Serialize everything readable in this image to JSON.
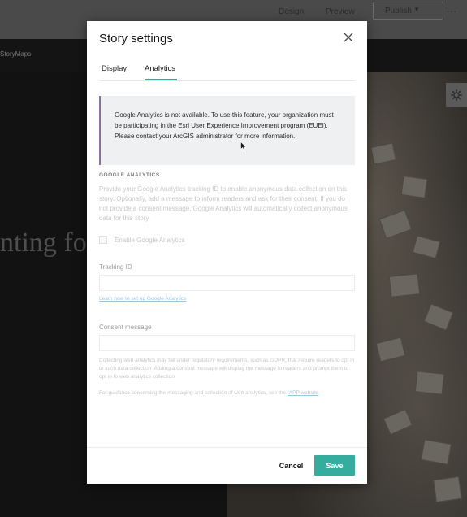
{
  "app": {
    "nav": {
      "design_label": "Design",
      "preview_label": "Preview",
      "publish_label": "Publish",
      "more_label": "..."
    },
    "brand_text": "StoryMaps",
    "hero_text": "nting fo"
  },
  "modal": {
    "title": "Story settings",
    "tabs": [
      {
        "label": "Display",
        "active": false
      },
      {
        "label": "Analytics",
        "active": true
      }
    ],
    "notice": {
      "text": "Google Analytics is not available. To use this feature, your organization must be participating in the Esri User Experience Improvement program (EUEI). Please contact your ArcGIS administrator for more information.",
      "accent_color": "#8f6fa3"
    },
    "section_heading": "GOOGLE ANALYTICS",
    "description": "Provide your Google Analytics tracking ID to enable anonymous data collection on this story. Optionally, add a message to inform readers and ask for their consent. If you do not provide a consent message, Google Analytics will automatically collect anonymous data for this story.",
    "enable_label": "Enable Google Analytics",
    "enable_checked": false,
    "tracking_label": "Tracking ID",
    "tracking_value": "",
    "learn_link": "Learn how to set up Google Analytics",
    "consent_label": "Consent message",
    "consent_value": "",
    "regulatory_text": "Collecting web analytics may fall under regulatory requirements, such as GDPR, that require readers to opt in to such data collection. Adding a consent message will display the message to readers and prompt them to opt in to web analytics collection.",
    "guidance_prefix": "For guidance concerning the messaging and collection of web analytics, see the ",
    "guidance_link": "IAPP website",
    "guidance_suffix": ".",
    "cancel_label": "Cancel",
    "save_label": "Save"
  },
  "colors": {
    "accent": "#35ac9e",
    "link": "#9fc6d8",
    "notice_bg": "#eef0f2"
  },
  "icons": {
    "close": "close-icon",
    "gear": "gear-icon",
    "chevron": "chevron-down-icon",
    "cursor": "cursor-icon"
  }
}
